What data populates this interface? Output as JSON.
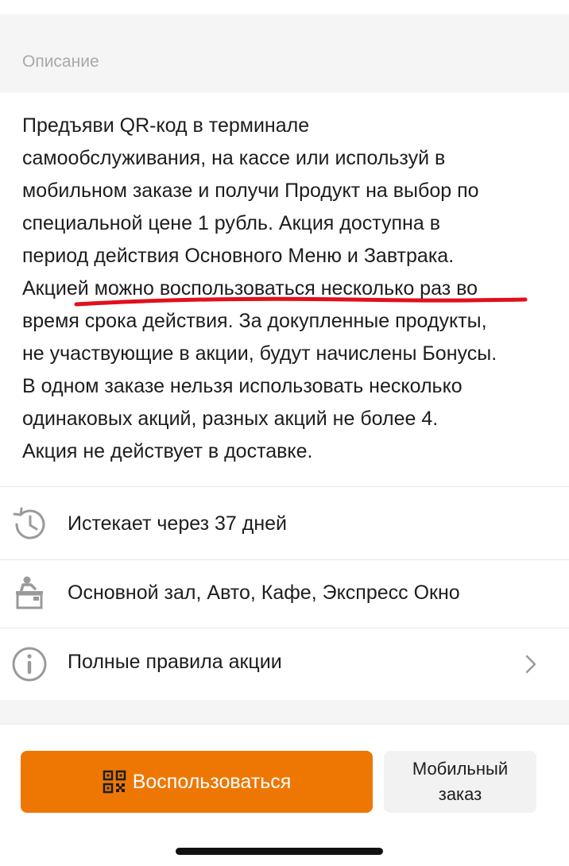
{
  "section": {
    "title": "Описание"
  },
  "description": {
    "lines": [
      "Предъяви QR-код в терминале",
      "самообслуживания, на кассе или используй в",
      "мобильном заказе и получи Продукт на выбор по",
      "специальной цене 1 рубль. Акция доступна в",
      "период действия Основного Меню и Завтрака.",
      "Акцией можно воспользоваться несколько раз во",
      "время срока действия. За докупленные продукты,",
      "не участвующие в акции, будут начислены Бонусы.",
      "В одном заказе нельзя использовать несколько",
      "одинаковых акций, разных акций не более 4.",
      "Акция не действует в доставке."
    ]
  },
  "info_rows": [
    {
      "icon": "history-clock-icon",
      "text": "Истекает через 37 дней"
    },
    {
      "icon": "cashier-desk-icon",
      "text": "Основной зал, Авто, Кафе, Экспресс Окно"
    },
    {
      "icon": "info-icon",
      "text": "Полные правила акции",
      "chevron": "chevron-right-icon"
    }
  ],
  "actions": {
    "use_label": "Воспользоваться",
    "use_icon": "qr-code-icon",
    "mobile_order_line1": "Мобильный",
    "mobile_order_line2": "заказ"
  },
  "colors": {
    "accent": "#ee7704",
    "underline": "#e0101c",
    "muted_text": "#a9a9a9",
    "section_bg": "#f5f5f5"
  }
}
